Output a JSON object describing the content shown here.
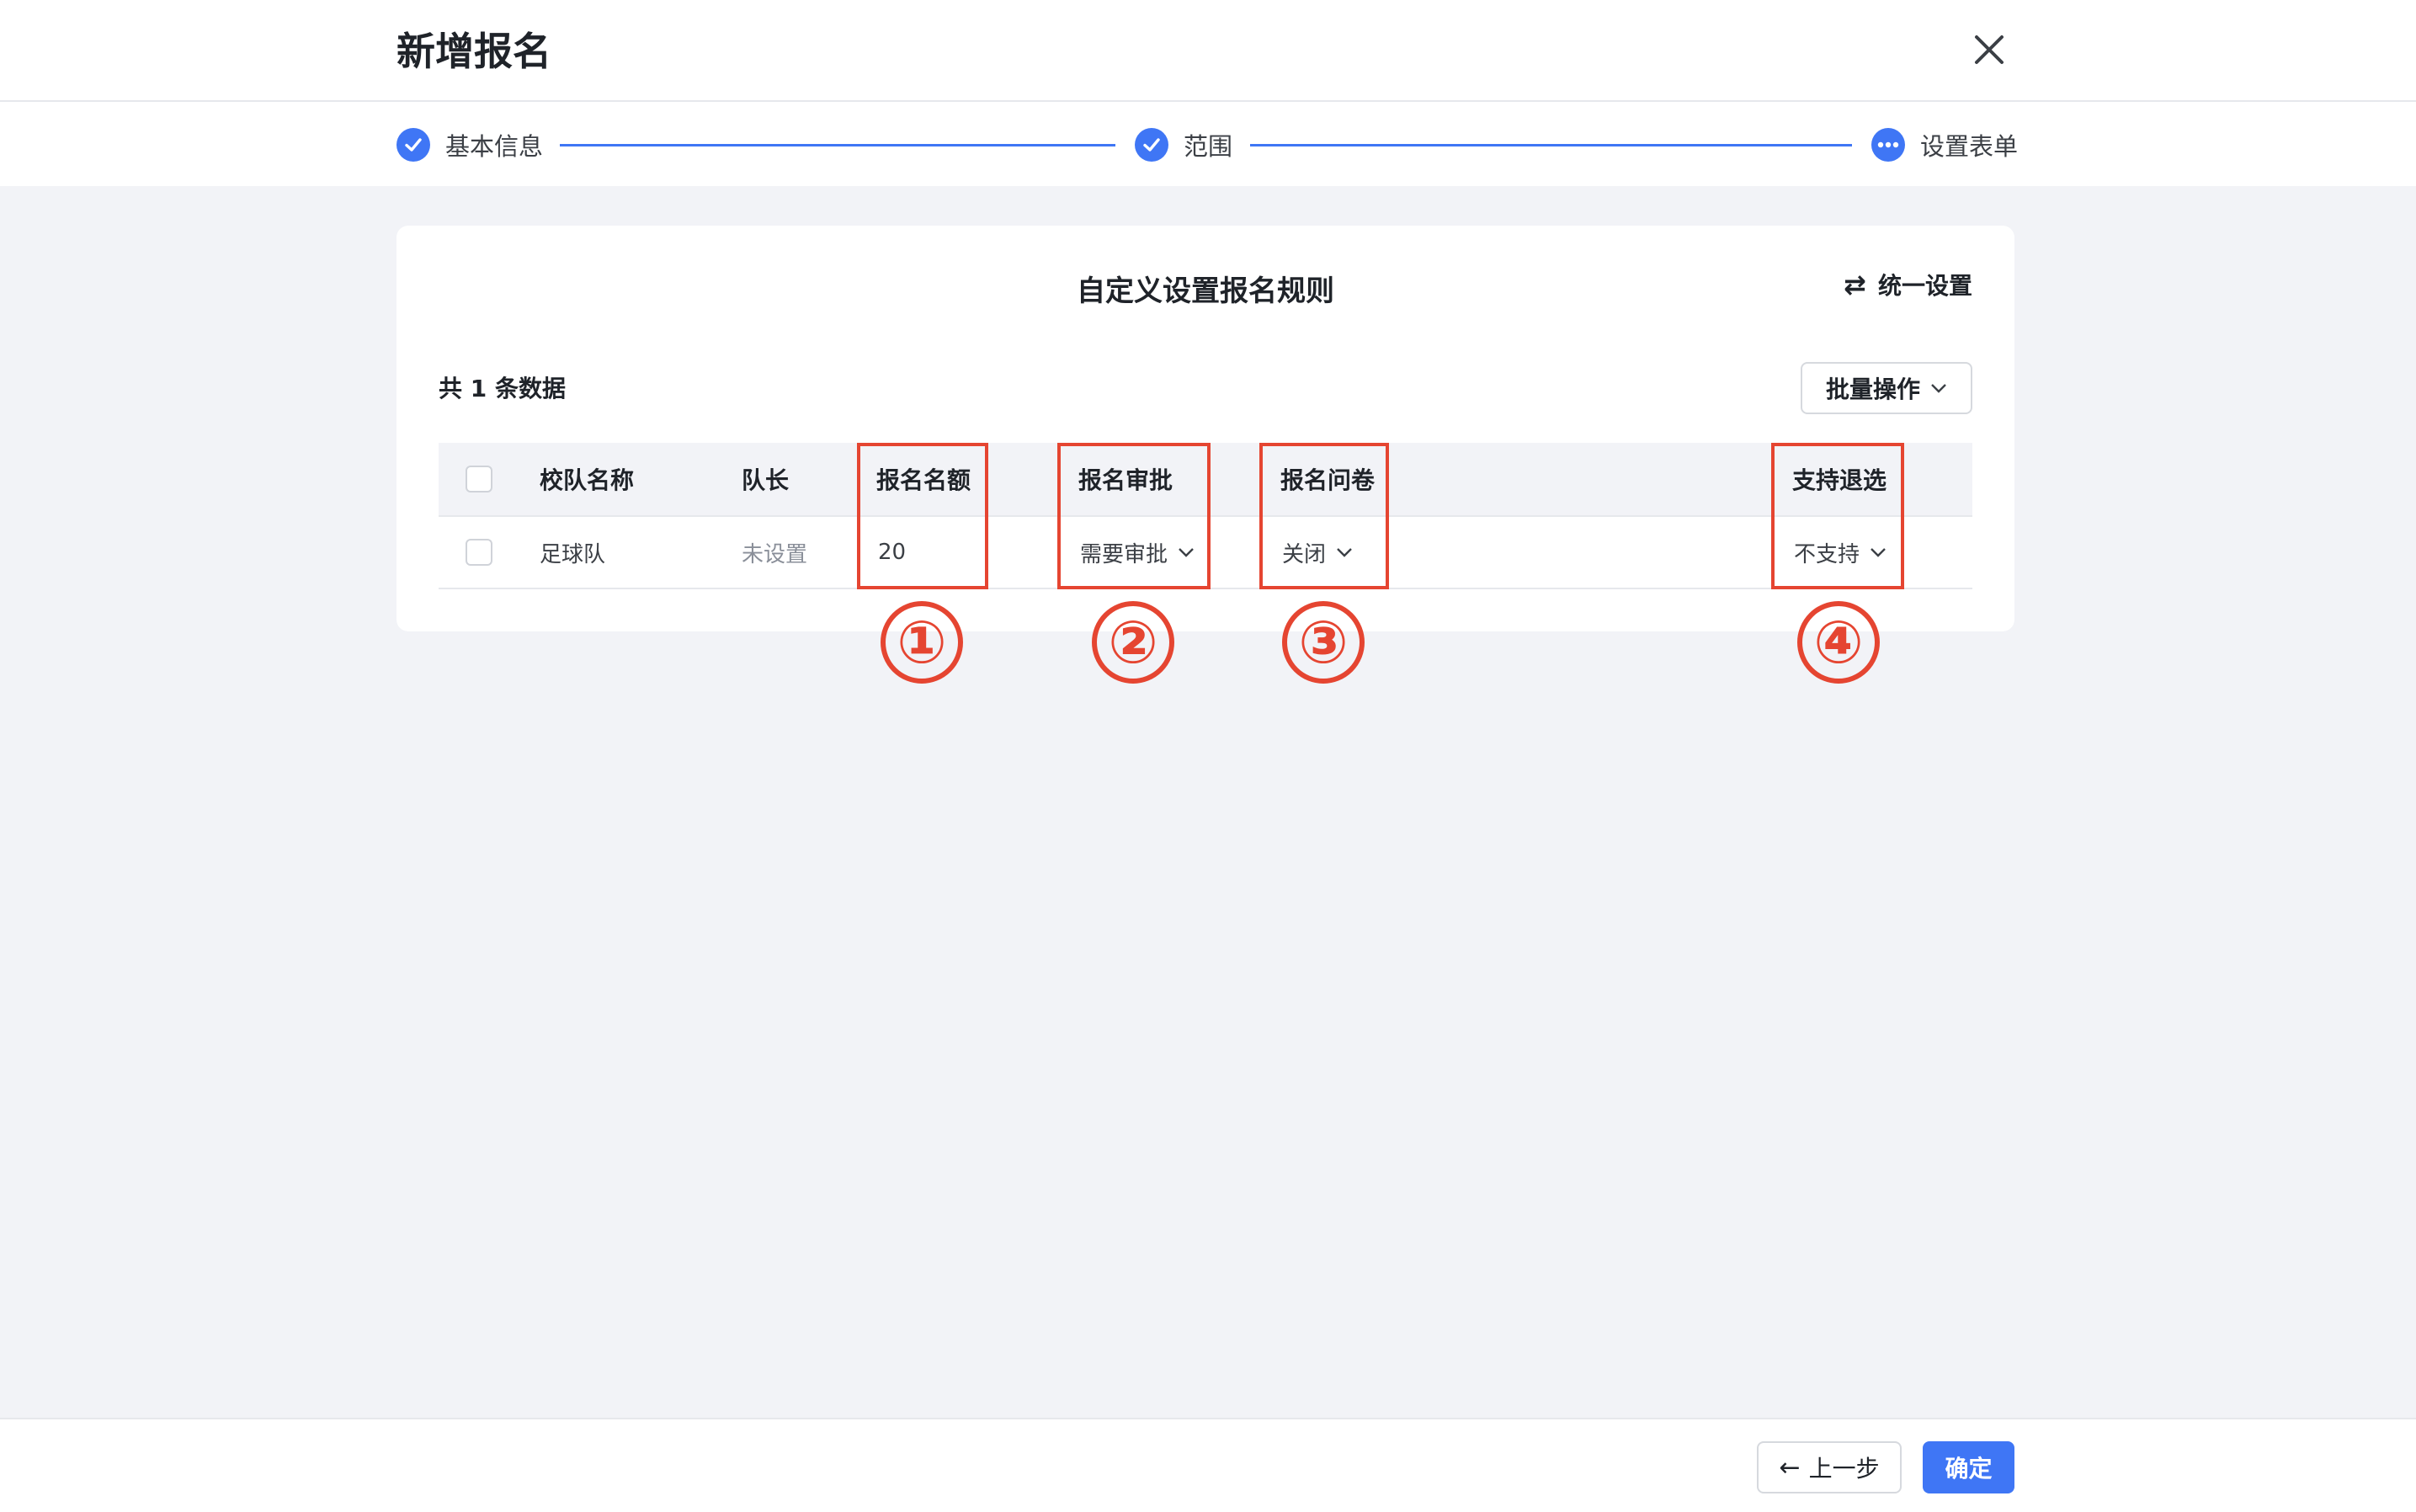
{
  "header": {
    "title": "新增报名"
  },
  "steps": [
    {
      "label": "基本信息",
      "status": "done"
    },
    {
      "label": "范围",
      "status": "done"
    },
    {
      "label": "设置表单",
      "status": "current"
    }
  ],
  "card": {
    "title": "自定义设置报名规则",
    "unify_label": "统一设置",
    "count_text": "共 1 条数据",
    "batch_label": "批量操作"
  },
  "table": {
    "columns": [
      "校队名称",
      "队长",
      "报名名额",
      "报名审批",
      "报名问卷",
      "支持退选"
    ],
    "rows": [
      {
        "team": "足球队",
        "captain": "未设置",
        "quota": "20",
        "approval": "需要审批",
        "questionnaire": "关闭",
        "withdraw": "不支持"
      }
    ]
  },
  "annotations": [
    "①",
    "②",
    "③",
    "④"
  ],
  "footer": {
    "prev_label": "上一步",
    "confirm_label": "确定"
  },
  "colors": {
    "accent": "#3f76f5",
    "annotation": "#e54531",
    "background": "#f2f3f7"
  }
}
